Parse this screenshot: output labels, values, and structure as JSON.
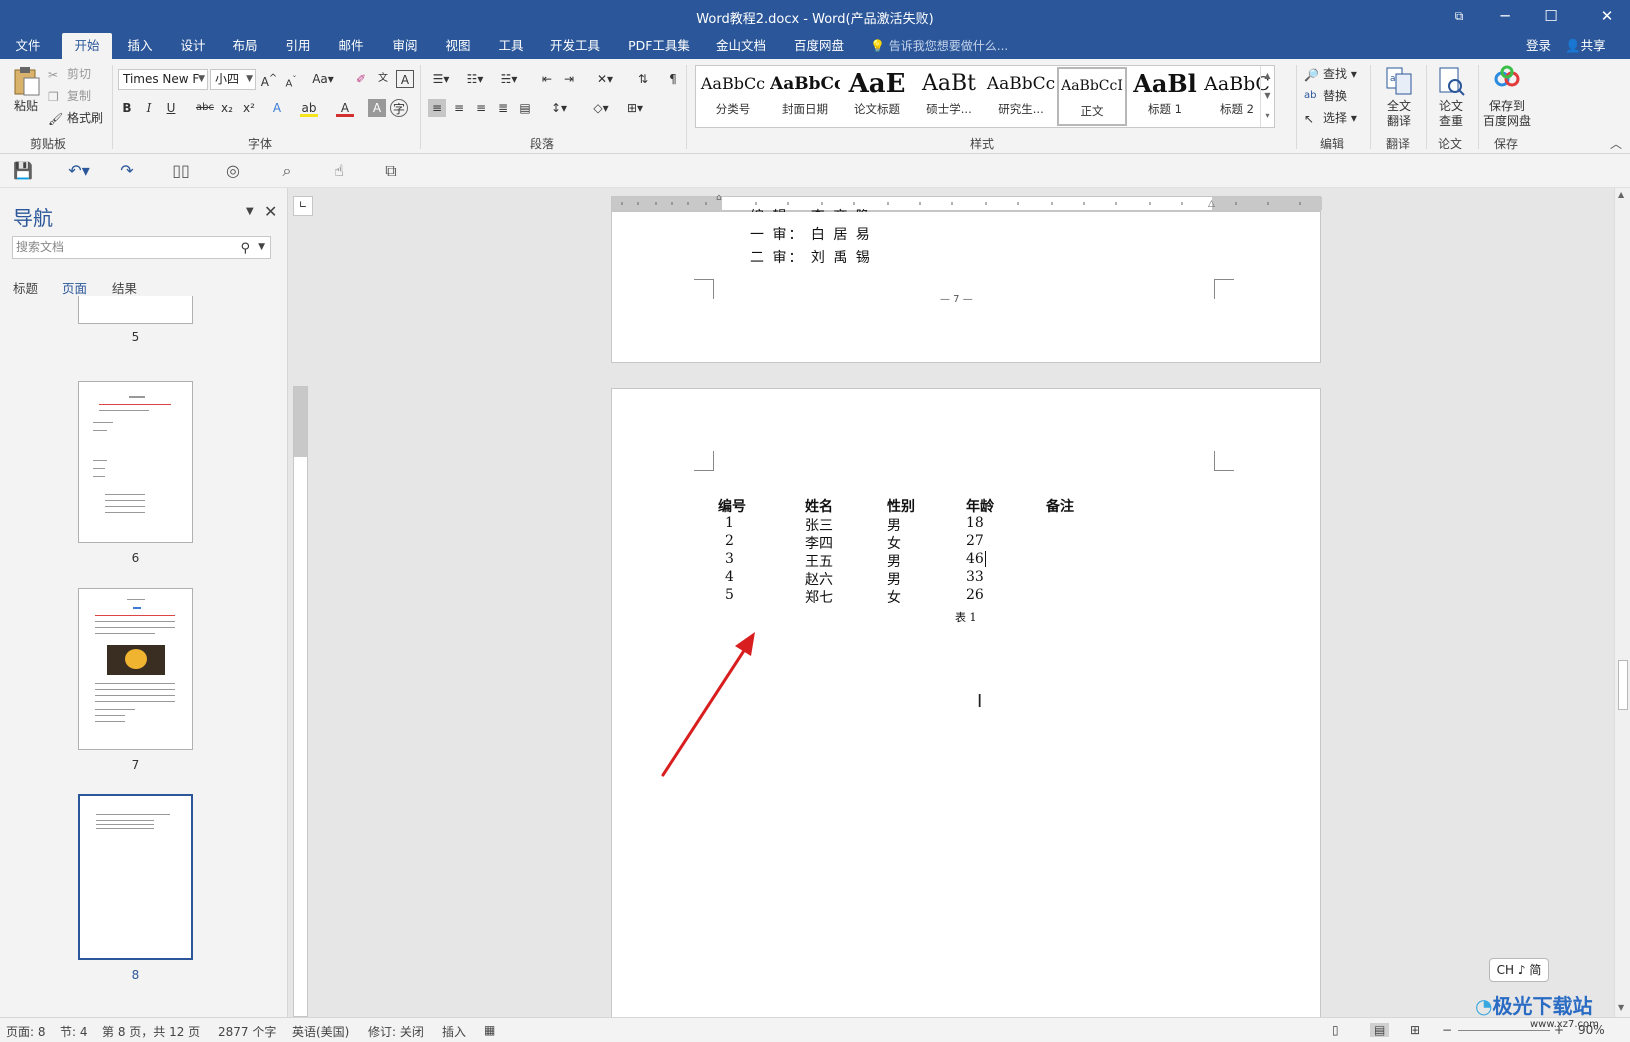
{
  "window": {
    "title": "Word教程2.docx - Word(产品激活失败)"
  },
  "tabs": [
    {
      "label": "文件"
    },
    {
      "label": "开始"
    },
    {
      "label": "插入"
    },
    {
      "label": "设计"
    },
    {
      "label": "布局"
    },
    {
      "label": "引用"
    },
    {
      "label": "邮件"
    },
    {
      "label": "审阅"
    },
    {
      "label": "视图"
    },
    {
      "label": "工具"
    },
    {
      "label": "开发工具"
    },
    {
      "label": "PDF工具集"
    },
    {
      "label": "金山文档"
    },
    {
      "label": "百度网盘"
    }
  ],
  "tellme": "告诉我您想要做什么...",
  "account": {
    "login": "登录",
    "share": "共享"
  },
  "clipboard": {
    "paste": "粘贴",
    "cut": "剪切",
    "copy": "复制",
    "format_painter": "格式刷",
    "label": "剪贴板"
  },
  "font": {
    "name": "Times New F",
    "size": "小四",
    "label": "字体"
  },
  "paragraph": {
    "label": "段落"
  },
  "styles": {
    "label": "样式",
    "items": [
      {
        "sample": "AaBbCc",
        "name": "分类号"
      },
      {
        "sample": "AaBbCc",
        "name": "封面日期"
      },
      {
        "sample": "AaE",
        "name": "论文标题"
      },
      {
        "sample": "AaBt",
        "name": "硕士学..."
      },
      {
        "sample": "AaBbCc",
        "name": "研究生..."
      },
      {
        "sample": "AaBbCcI",
        "name": "正文"
      },
      {
        "sample": "AaBl",
        "name": "标题 1"
      },
      {
        "sample": "AaBbC",
        "name": "标题 2"
      }
    ]
  },
  "editing": {
    "find": "查找",
    "replace": "替换",
    "select": "选择",
    "label": "编辑"
  },
  "translate": {
    "btn_line1": "全文",
    "btn_line2": "翻译",
    "label": "翻译"
  },
  "thesis": {
    "btn_line1": "论文",
    "btn_line2": "查重",
    "label": "论文"
  },
  "save": {
    "btn_line1": "保存到",
    "btn_line2": "百度网盘",
    "label": "保存"
  },
  "nav": {
    "title": "导航",
    "search_placeholder": "搜索文档",
    "tabs": [
      "标题",
      "页面",
      "结果"
    ],
    "pages": [
      "5",
      "6",
      "7",
      "8"
    ]
  },
  "document": {
    "prev_page_lines": [
      "一 审： 白 居 易",
      "二 审： 刘 禹 锡"
    ],
    "prev_page_footer": "— 7 —",
    "table_headers": [
      "编号",
      "姓名",
      "性别",
      "年龄",
      "备注"
    ],
    "table_rows": [
      [
        "1",
        "张三",
        "男",
        "18"
      ],
      [
        "2",
        "李四",
        "女",
        "27"
      ],
      [
        "3",
        "王五",
        "男",
        "46"
      ],
      [
        "4",
        "赵六",
        "男",
        "33"
      ],
      [
        "5",
        "郑七",
        "女",
        "26"
      ]
    ],
    "caption": "表 1"
  },
  "status": {
    "page": "页面: 8",
    "section": "节: 4",
    "page_of": "第 8 页，共 12 页",
    "words": "2877 个字",
    "lang": "英语(美国)",
    "track": "修订: 关闭",
    "mode": "插入",
    "zoom": "90%"
  },
  "ime": "CH ♪ 简",
  "watermark": {
    "name": "极光下载站",
    "url": "www.xz7.com"
  },
  "colors": {
    "accent": "#2b579a",
    "arrow": "#d81e1e"
  }
}
